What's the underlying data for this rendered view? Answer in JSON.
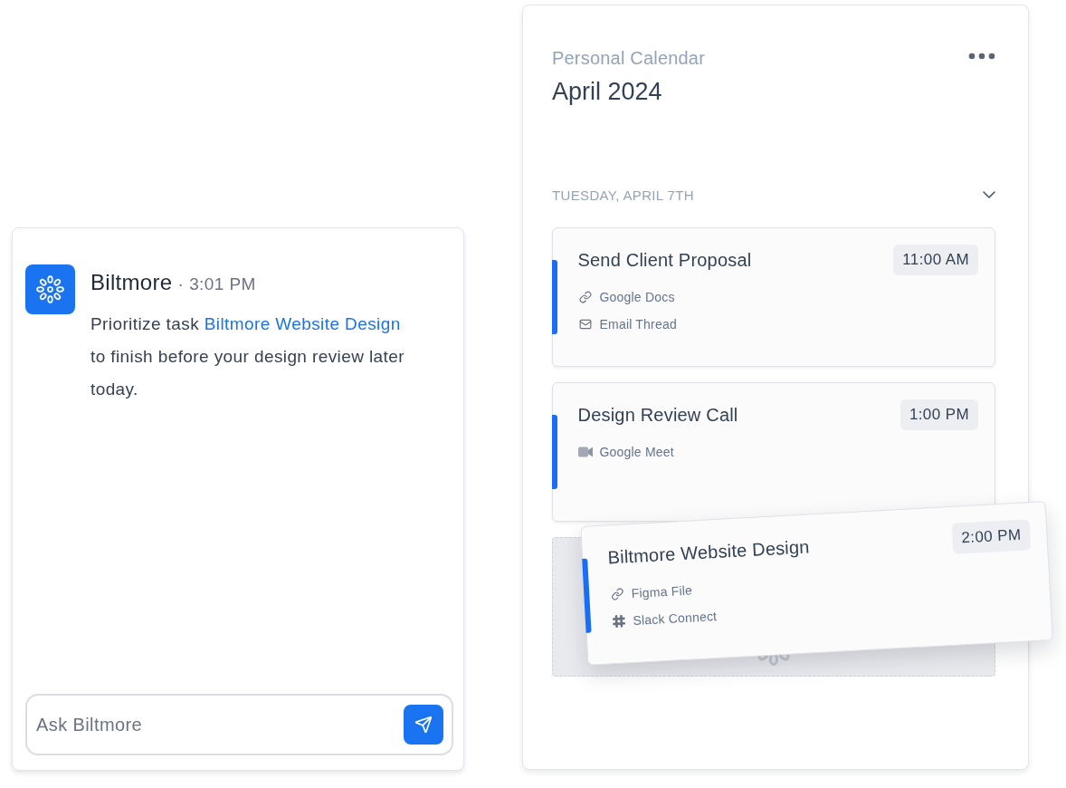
{
  "chat": {
    "message": {
      "sender": "Biltmore",
      "separator": "·",
      "time": "3:01 PM",
      "body": [
        {
          "kind": "text",
          "text": "Prioritize task "
        },
        {
          "kind": "link",
          "text": "Biltmore Website Design"
        },
        {
          "kind": "text",
          "text": " to finish before your design review later today."
        }
      ]
    },
    "composer": {
      "placeholder": "Ask Biltmore"
    }
  },
  "calendar": {
    "subtitle": "Personal Calendar",
    "title": "April 2024",
    "day": {
      "label": "TUESDAY, APRIL 7TH",
      "expanded": true,
      "events": [
        {
          "title": "Send Client Proposal",
          "time": "11:00 AM",
          "dragging": false,
          "attachments": [
            {
              "kind": "link",
              "label": "Google Docs"
            },
            {
              "kind": "email",
              "label": "Email Thread"
            }
          ]
        },
        {
          "title": "Design Review Call",
          "time": "1:00 PM",
          "dragging": false,
          "attachments": [
            {
              "kind": "video",
              "label": "Google Meet"
            }
          ]
        },
        {
          "title": "Biltmore Website Design",
          "time": "2:00 PM",
          "dragging": true,
          "attachments": [
            {
              "kind": "link",
              "label": "Figma File"
            },
            {
              "kind": "chat",
              "label": "Slack Connect"
            }
          ]
        }
      ]
    }
  }
}
